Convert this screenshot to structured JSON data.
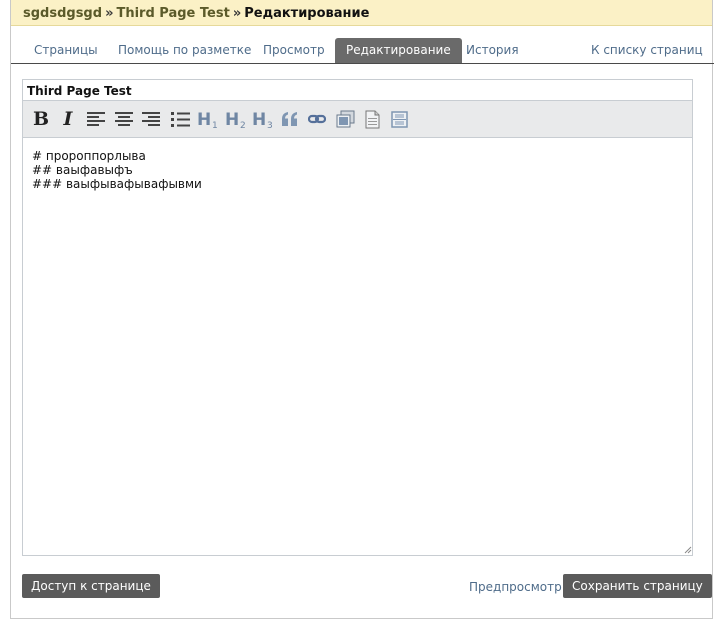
{
  "breadcrumb": {
    "project": "sgdsdgsgd",
    "page": "Third Page Test",
    "current": "Редактирование",
    "separator": "»"
  },
  "tabs": [
    {
      "label": "Страницы"
    },
    {
      "label": "Помощь по разметке"
    },
    {
      "label": "Просмотр"
    },
    {
      "label": "Редактирование",
      "active": true
    },
    {
      "label": "История"
    }
  ],
  "back_link": "К списку страниц",
  "editor": {
    "title": "Third Page Test",
    "content": "# пророппорлыва\n## ваыфавыфъ\n### ваыфывафывафывми"
  },
  "toolbar": {
    "bold": "B",
    "italic": "I"
  },
  "buttons": {
    "access": "Доступ к странице",
    "preview": "Предпросмотр",
    "save": "Сохранить страницу"
  },
  "colors": {
    "accent_bg": "#fbf1c6",
    "tab_active": "#6a6a6a",
    "link": "#4f6c8a",
    "button": "#5b5b5b"
  }
}
